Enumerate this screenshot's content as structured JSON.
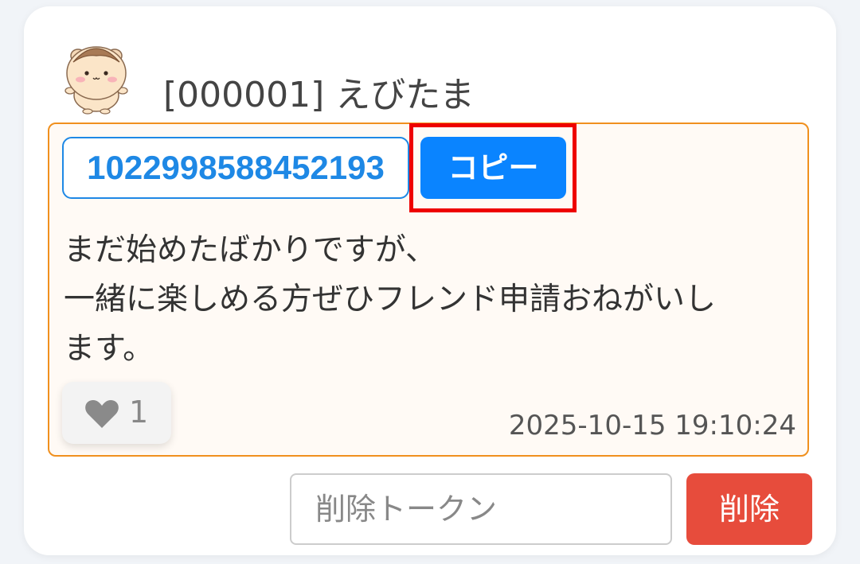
{
  "post": {
    "user_label": "[000001] えびたま",
    "friend_code": "1022998588452193",
    "copy_label": "コピー",
    "message_lines": [
      "まだ始めたばかりですが、",
      "一緒に楽しめる方ぜひフレンド申請おねがいし",
      "ます。"
    ],
    "like_count": "1",
    "timestamp": "2025-10-15 19:10:24"
  },
  "delete_form": {
    "token_placeholder": "削除トークン",
    "token_value": "",
    "delete_label": "削除"
  },
  "icons": {
    "avatar": "hamster-avatar-icon",
    "like": "heart-icon"
  },
  "colors": {
    "accent_blue": "#0a84ff",
    "post_border": "#f0901e",
    "highlight_red": "#ee0000",
    "delete_red": "#e74c3c"
  }
}
